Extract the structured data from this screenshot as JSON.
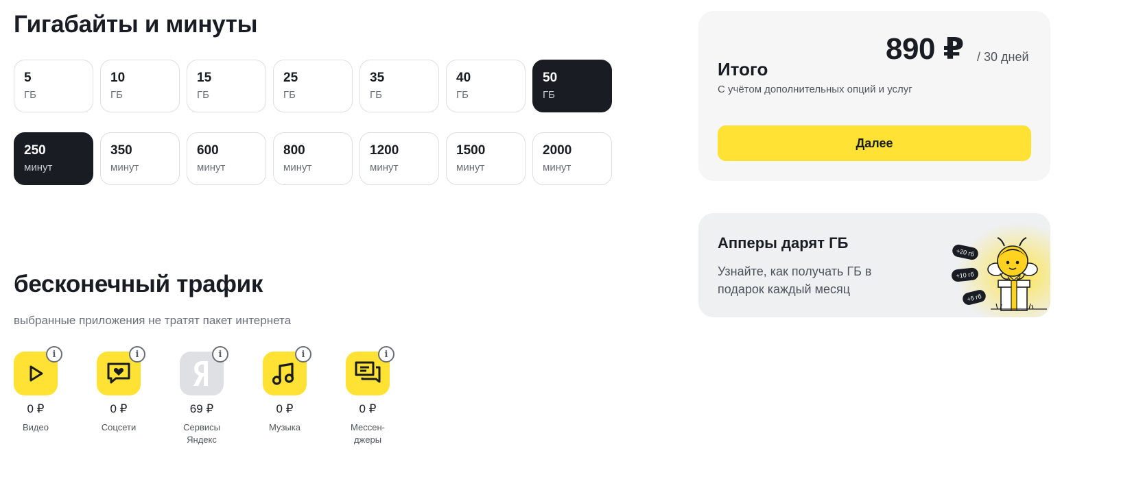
{
  "gigabytes_section": {
    "title": "Гигабайты и минуты",
    "gb_options": [
      {
        "value": "5",
        "unit": "ГБ",
        "selected": false
      },
      {
        "value": "10",
        "unit": "ГБ",
        "selected": false
      },
      {
        "value": "15",
        "unit": "ГБ",
        "selected": false
      },
      {
        "value": "25",
        "unit": "ГБ",
        "selected": false
      },
      {
        "value": "35",
        "unit": "ГБ",
        "selected": false
      },
      {
        "value": "40",
        "unit": "ГБ",
        "selected": false
      },
      {
        "value": "50",
        "unit": "ГБ",
        "selected": true
      }
    ],
    "minute_options": [
      {
        "value": "250",
        "unit": "минут",
        "selected": true
      },
      {
        "value": "350",
        "unit": "минут",
        "selected": false
      },
      {
        "value": "600",
        "unit": "минут",
        "selected": false
      },
      {
        "value": "800",
        "unit": "минут",
        "selected": false
      },
      {
        "value": "1200",
        "unit": "минут",
        "selected": false
      },
      {
        "value": "1500",
        "unit": "минут",
        "selected": false
      },
      {
        "value": "2000",
        "unit": "минут",
        "selected": false
      }
    ]
  },
  "unlimited_section": {
    "title": "бесконечный трафик",
    "subtitle": "выбранные приложения не тратят пакет интернета",
    "apps": [
      {
        "icon": "play-icon",
        "price": "0 ₽",
        "name": "Видео",
        "tile": "yellow"
      },
      {
        "icon": "chat-heart-icon",
        "price": "0 ₽",
        "name": "Соцсети",
        "tile": "yellow"
      },
      {
        "icon": "yandex-logo-icon",
        "price": "69 ₽",
        "name": "Сервисы Яндекс",
        "tile": "gray"
      },
      {
        "icon": "music-note-icon",
        "price": "0 ₽",
        "name": "Музыка",
        "tile": "yellow"
      },
      {
        "icon": "messages-icon",
        "price": "0 ₽",
        "name": "Мессен-джеры",
        "tile": "yellow"
      }
    ],
    "info_glyph": "i"
  },
  "total_card": {
    "label": "Итого",
    "price": "890 ₽",
    "period": "/ 30 дней",
    "note": "С учётом дополнительных опций и услуг",
    "next_button": "Далее"
  },
  "promo_card": {
    "title": "Апперы дарят ГБ",
    "text": "Узнайте, как получать ГБ в подарок каждый месяц",
    "badges": [
      "+20 гб",
      "+10 гб",
      "+5 гб"
    ]
  },
  "colors": {
    "accent_yellow": "#ffe234",
    "selected_dark": "#191c22",
    "card_bg": "#f6f6f7",
    "promo_bg": "#eef0f2"
  }
}
